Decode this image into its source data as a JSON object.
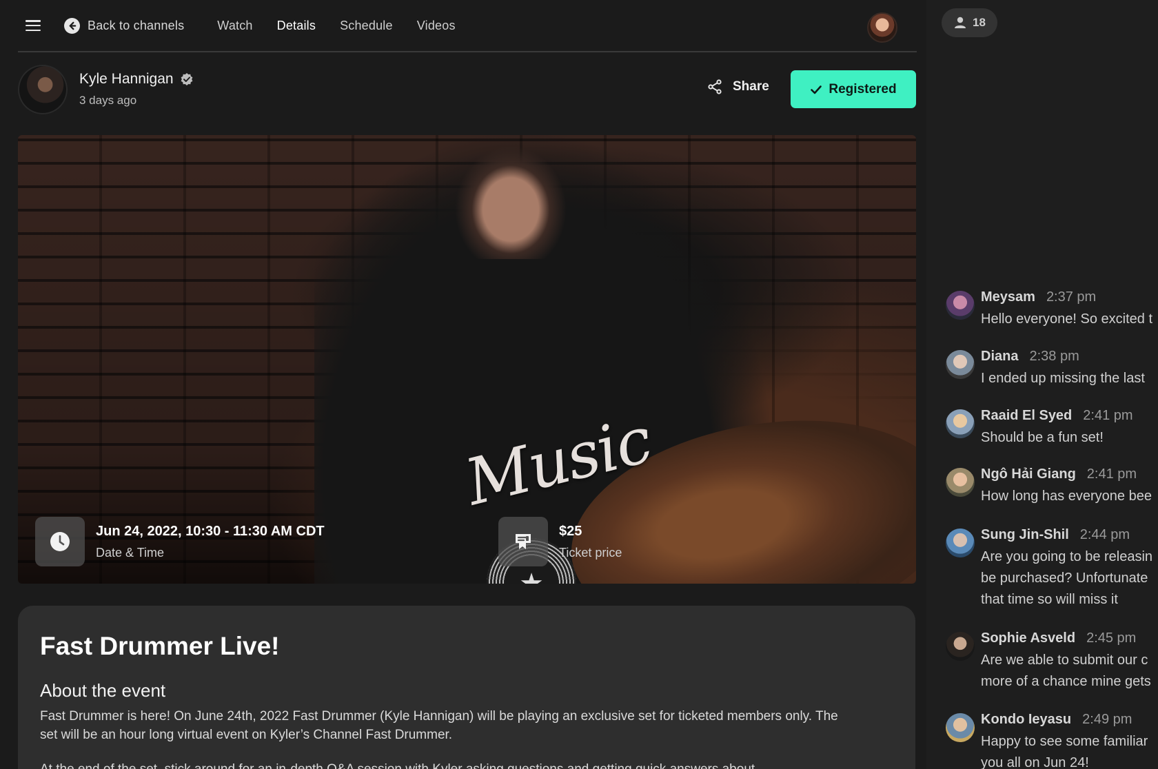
{
  "nav": {
    "back_label": "Back to channels",
    "tabs": [
      {
        "label": "Watch"
      },
      {
        "label": "Details"
      },
      {
        "label": "Schedule"
      },
      {
        "label": "Videos"
      }
    ],
    "active_tab": "Details"
  },
  "creator": {
    "name": "Kyle Hannigan",
    "posted": "3 days ago",
    "share_label": "Share",
    "registered_label": "Registered"
  },
  "hero": {
    "shirt_text": "Music",
    "datetime": "Jun 24, 2022, 10:30 - 11:30 AM CDT",
    "datetime_label": "Date & Time",
    "price": "$25",
    "price_label": "Ticket price"
  },
  "event": {
    "title": "Fast Drummer Live!",
    "about_heading": "About the event",
    "about_body": "Fast Drummer is here! On June 24th, 2022 Fast Drummer (Kyle Hannigan) will be playing an exclusive set for ticketed members only. The set will be an hour long virtual event on Kyler’s Channel Fast Drummer.",
    "about_body_2": "At the end of the set, stick around for an in-depth Q&A session with Kyler asking questions and getting quick answers about"
  },
  "chat": {
    "viewer_count": "18",
    "messages": [
      {
        "user": "Meysam",
        "time": "2:37 pm",
        "text": "Hello everyone! So excited t"
      },
      {
        "user": "Diana",
        "time": "2:38 pm",
        "text": "I ended up missing the last"
      },
      {
        "user": "Raaid El Syed",
        "time": "2:41 pm",
        "text": "Should be a fun set!"
      },
      {
        "user": "Ngô Hải Giang",
        "time": "2:41 pm",
        "text": "How long has everyone bee"
      },
      {
        "user": "Sung Jin-Shil",
        "time": "2:44 pm",
        "text": "Are you going to be releasin\nbe purchased? Unfortunate\nthat time so will miss it"
      },
      {
        "user": "Sophie Asveld",
        "time": "2:45 pm",
        "text": "Are we able to submit our c\nmore of a chance mine gets"
      },
      {
        "user": "Kondo Ieyasu",
        "time": "2:49 pm",
        "text": "Happy to see some familiar\nyou all on Jun 24!"
      }
    ]
  },
  "colors": {
    "accent": "#3ff0c2",
    "background": "#1b1b1b",
    "card": "#2e2e2e"
  },
  "icons": [
    "menu-icon",
    "back-arrow-icon",
    "verified-icon",
    "share-icon",
    "check-icon",
    "clock-icon",
    "ticket-icon",
    "user-icon"
  ]
}
